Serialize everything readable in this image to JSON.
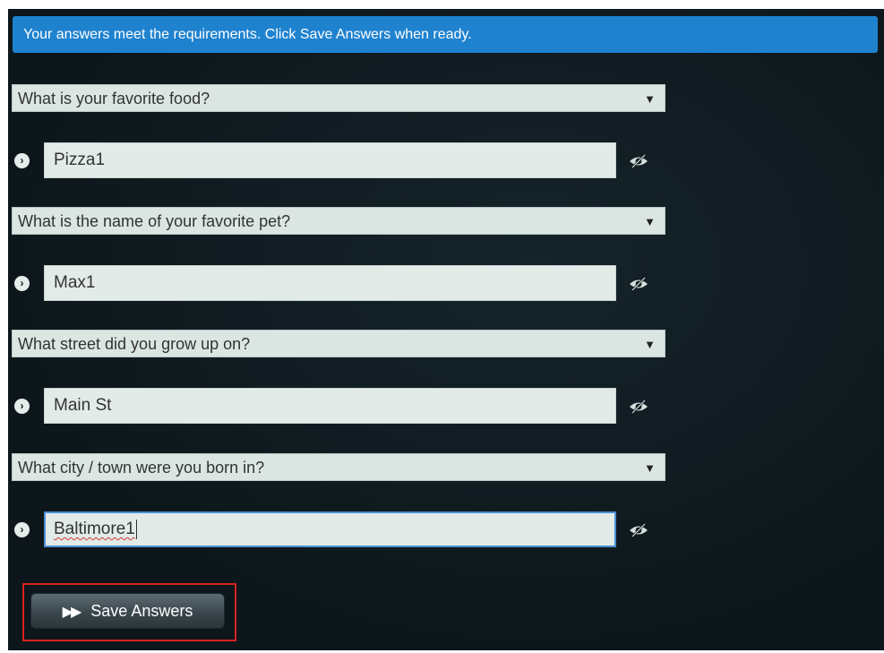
{
  "banner": {
    "message": "Your answers meet the requirements. Click Save Answers when ready."
  },
  "questions": [
    {
      "selected": "What is your favorite food?",
      "answer": "Pizza1"
    },
    {
      "selected": "What is the name of your favorite pet?",
      "answer": "Max1"
    },
    {
      "selected": "What street did you grow up on?",
      "answer": "Main St"
    },
    {
      "selected": "What city / town were you born in?",
      "answer": "Baltimore1"
    }
  ],
  "icons": {
    "dropdown": "caret-down-icon",
    "bullet": "chevron-right-circle-icon",
    "toggle_visibility": "eye-slash-icon",
    "save": "fast-forward-icon"
  },
  "save": {
    "label": "Save Answers"
  },
  "colors": {
    "banner": "#1f82cf",
    "highlight_frame": "#d92121",
    "active_border": "#4b8fd6"
  }
}
